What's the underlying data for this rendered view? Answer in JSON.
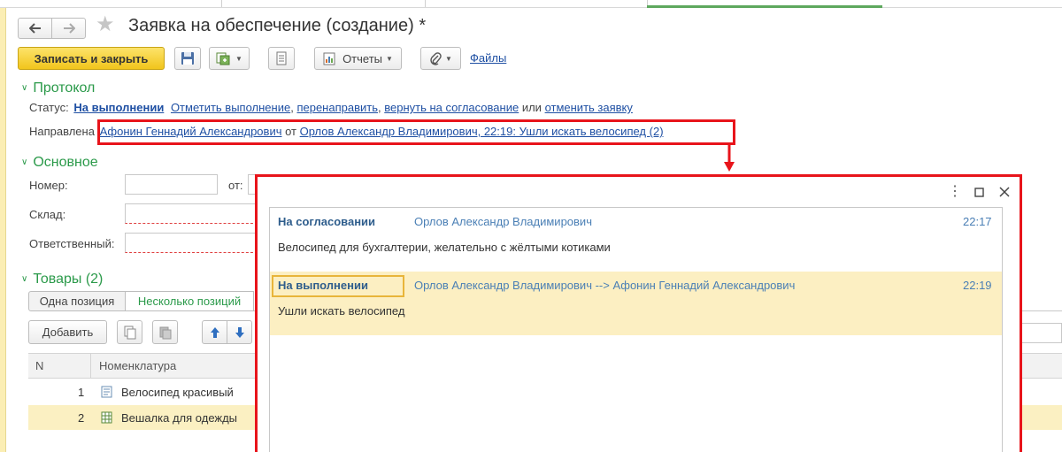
{
  "window": {
    "title": "Заявка на обеспечение (создание) *"
  },
  "toolbar": {
    "save_close_label": "Записать и закрыть",
    "reports_label": "Отчеты",
    "files_label": "Файлы"
  },
  "protocol": {
    "section_title": "Протокол",
    "status_label": "Статус:",
    "status_value": "На выполнении",
    "action_mark_done": "Отметить выполнение",
    "action_redirect": "перенаправить",
    "action_return": "вернуть на согласование",
    "or_word": "или",
    "action_cancel": "отменить заявку",
    "directed_label": "Направлена",
    "directed_to": "Афонин Геннадий Александрович",
    "from_word": "от",
    "directed_from": "Орлов Александр Владимирович, 22:19: Ушли искать велосипед (2)"
  },
  "main": {
    "section_title": "Основное",
    "number_label": "Номер:",
    "number_value": "",
    "date_from_label": "от:",
    "warehouse_label": "Склад:",
    "responsible_label": "Ответственный:"
  },
  "goods": {
    "section_title": "Товары (2)",
    "tab_single": "Одна позиция",
    "tab_multiple": "Несколько позиций",
    "add_label": "Добавить",
    "columns": [
      "N",
      "Номенклатура"
    ],
    "rows": [
      {
        "n": "1",
        "name": "Велосипед красивый"
      },
      {
        "n": "2",
        "name": "Вешалка для одежды"
      }
    ]
  },
  "popup": {
    "messages": [
      {
        "status": "На согласовании",
        "author": "Орлов Александр Владимирович",
        "time": "22:17",
        "text": "Велосипед для бухгалтерии, желательно с жёлтыми котиками"
      },
      {
        "status": "На выполнении",
        "author": "Орлов Александр Владимирович --> Афонин Геннадий Александрович",
        "time": "22:19",
        "text": "Ушли искать велосипед"
      }
    ]
  },
  "colors": {
    "accent_yellow": "#f1c51c",
    "section_green": "#2b9a4a",
    "link_blue": "#1e4fa3",
    "highlight_red": "#e8141b",
    "selected_row": "#fbf0c2"
  }
}
